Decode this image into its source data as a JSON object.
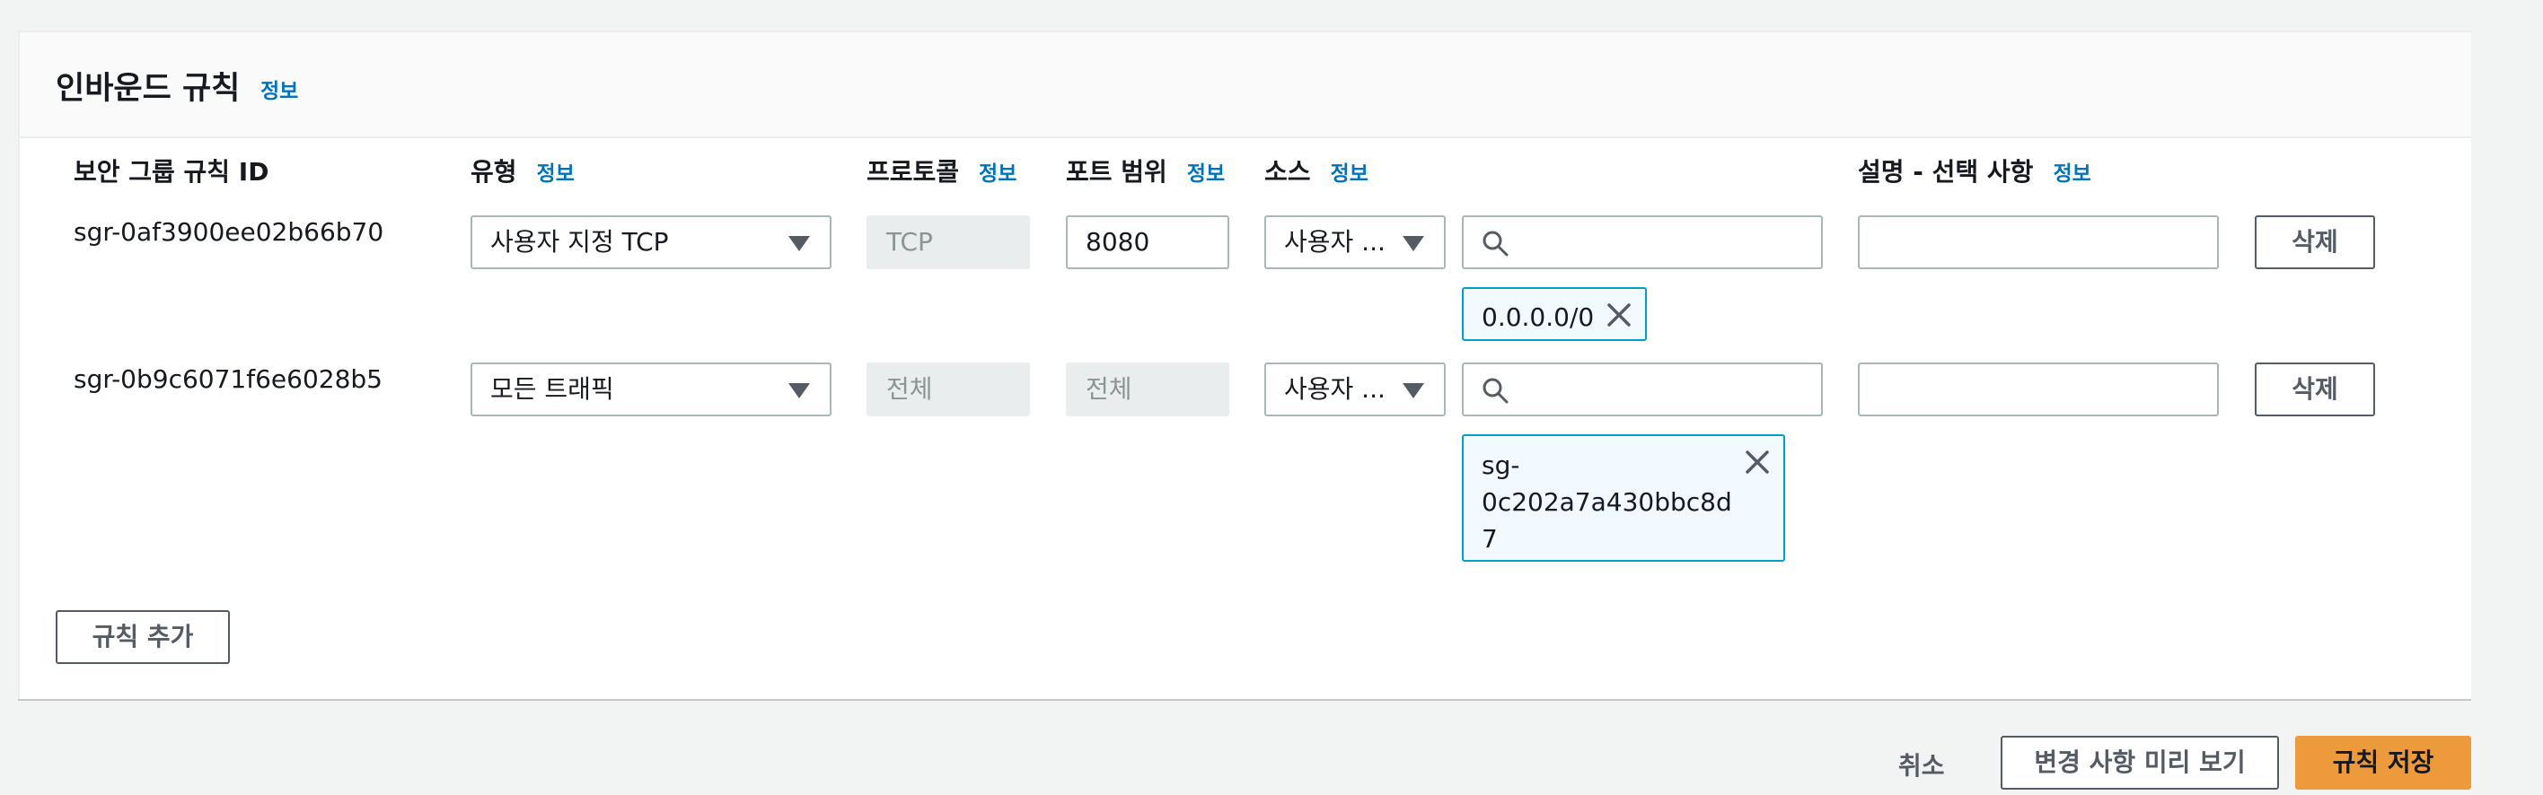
{
  "section": {
    "title": "인바운드 규칙",
    "info_label": "정보"
  },
  "columns": [
    {
      "label": "보안 그룹 규칙 ID",
      "info": ""
    },
    {
      "label": "유형",
      "info": "정보"
    },
    {
      "label": "프로토콜",
      "info": "정보"
    },
    {
      "label": "포트 범위",
      "info": "정보"
    },
    {
      "label": "소스",
      "info": "정보"
    },
    {
      "label": "설명 - 선택 사항",
      "info": "정보"
    }
  ],
  "rules": [
    {
      "id": "sgr-0af3900ee02b66b70",
      "type": "사용자 지정 TCP",
      "protocol": "TCP",
      "port_range": "8080",
      "source_type": "사용자 ...",
      "source_search": "",
      "source_token": "0.0.0.0/0",
      "description": "",
      "delete_label": "삭제"
    },
    {
      "id": "sgr-0b9c6071f6e6028b5",
      "type": "모든 트래픽",
      "protocol": "전체",
      "port_range": "전체",
      "source_type": "사용자 ...",
      "source_search": "",
      "source_token_lines": [
        "sg-",
        "0c202a7a430bbc8d",
        "7"
      ],
      "description": "",
      "delete_label": "삭제"
    }
  ],
  "add_rule_label": "규칙 추가",
  "footer": {
    "cancel_label": "취소",
    "preview_label": "변경 사항 미리 보기",
    "save_label": "규칙 저장"
  },
  "icons": {
    "search": "search-icon",
    "close": "close-icon",
    "caret": "caret-down-icon"
  },
  "colors": {
    "link": "#0073bb",
    "primary": "#ec9a3c",
    "token_border": "#00a1c9",
    "token_bg": "#f1faff"
  }
}
